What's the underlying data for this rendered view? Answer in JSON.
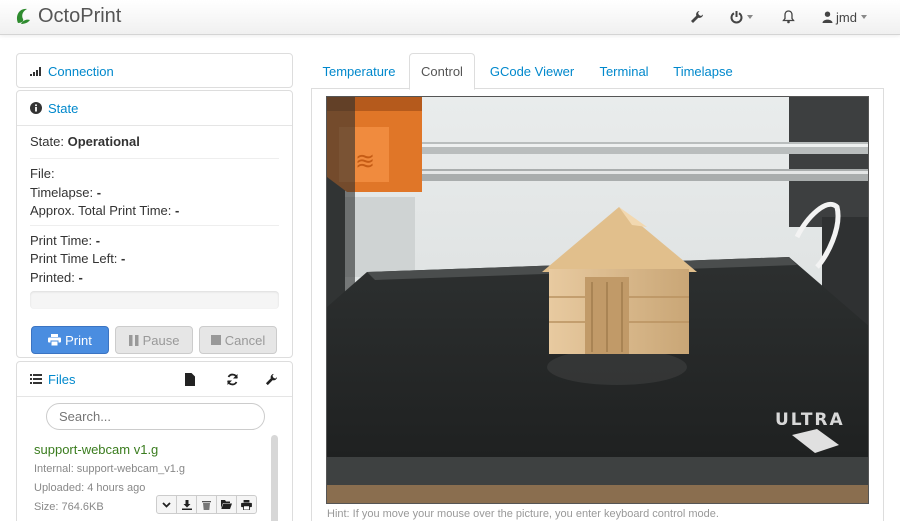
{
  "navbar": {
    "brand": "OctoPrint",
    "user": "jmd",
    "icons": [
      "wrench-icon",
      "power-icon",
      "bell-icon",
      "user-icon"
    ]
  },
  "connection": {
    "title": "Connection"
  },
  "state": {
    "title": "State",
    "state_label": "State:",
    "state_value": "Operational",
    "file_label": "File:",
    "timelapse_label": "Timelapse:",
    "timelapse_value": "-",
    "approx_label": "Approx. Total Print Time:",
    "approx_value": "-",
    "print_time_label": "Print Time:",
    "print_time_value": "-",
    "print_time_left_label": "Print Time Left:",
    "print_time_left_value": "-",
    "printed_label": "Printed:",
    "printed_value": "-",
    "progress": 0,
    "buttons": {
      "print": "Print",
      "pause": "Pause",
      "cancel": "Cancel"
    }
  },
  "files": {
    "title": "Files",
    "search_placeholder": "Search...",
    "items": [
      {
        "name": "support-webcam v1.g",
        "internal": "Internal: support-webcam_v1.g",
        "uploaded": "Uploaded: 4 hours ago",
        "size": "Size: 764.6KB"
      }
    ]
  },
  "tabs": [
    "Temperature",
    "Control",
    "GCode Viewer",
    "Terminal",
    "Timelapse"
  ],
  "active_tab": "Control",
  "control": {
    "hint": "Hint: If you move your mouse over the picture, you enter keyboard control mode.",
    "webcam_overlay_text": "ULTRA"
  },
  "colors": {
    "link": "#0088cc",
    "primary_button": "#4a8de0",
    "file_name": "#3a7c1e",
    "brand_logo": "#2e8b2e"
  }
}
